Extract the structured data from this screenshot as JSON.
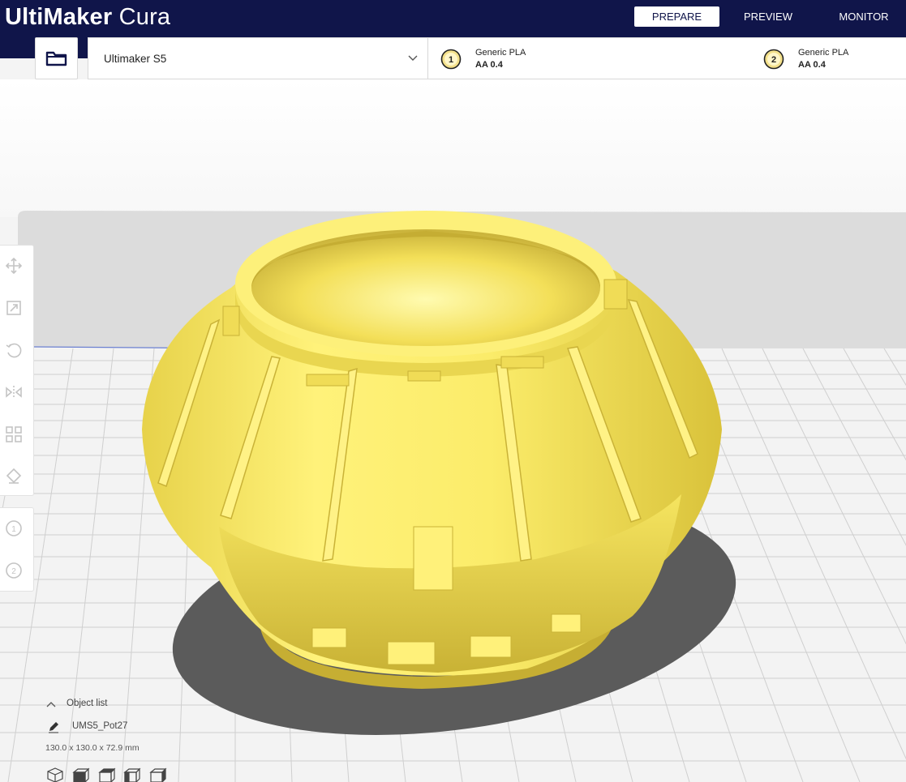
{
  "app": {
    "logo_bold": "UltiMaker",
    "logo_light": " Cura"
  },
  "stages": [
    "PREPARE",
    "PREVIEW",
    "MONITOR"
  ],
  "active_stage": "PREPARE",
  "machine": {
    "name": "Ultimaker S5"
  },
  "extruders": [
    {
      "index": "1",
      "material": "Generic PLA",
      "core": "AA 0.4"
    },
    {
      "index": "2",
      "material": "Generic PLA",
      "core": "AA 0.4"
    }
  ],
  "toolbar": {
    "tools": [
      "move-icon",
      "scale-icon",
      "rotate-icon",
      "mirror-icon",
      "per-model-settings-icon",
      "support-blocker-icon"
    ],
    "extruder_buttons": [
      "1",
      "2"
    ]
  },
  "object_list": {
    "header": "Object list",
    "object_name": "UMS5_Pot27",
    "dimensions": "130.0 x 130.0 x 72.9 mm",
    "view_buttons": [
      "3d-view-icon",
      "front-view-icon",
      "top-view-icon",
      "left-view-icon",
      "right-view-icon"
    ]
  },
  "colors": {
    "header_bg": "#10154a",
    "model_yellow": "#f5e25c",
    "build_plate": "#f2f2f2",
    "grid_line": "#c9c9c9"
  }
}
